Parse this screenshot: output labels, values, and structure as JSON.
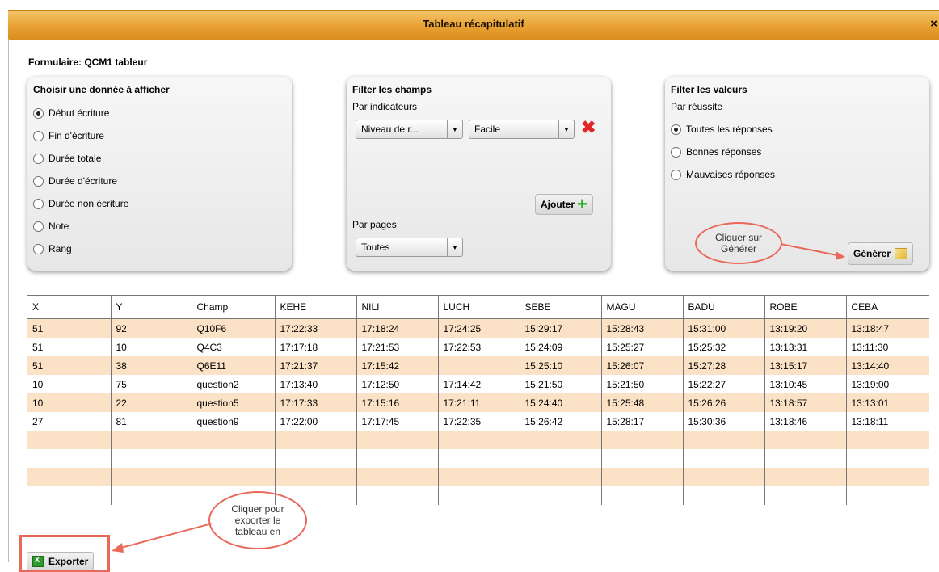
{
  "window": {
    "title": "Tableau récapitulatif",
    "close_label": "×"
  },
  "form_title": "Formulaire: QCM1 tableur",
  "panel_display": {
    "title": "Choisir une donnée à afficher",
    "options": [
      {
        "label": "Début écriture",
        "selected": true
      },
      {
        "label": "Fin d'écriture",
        "selected": false
      },
      {
        "label": "Durée totale",
        "selected": false
      },
      {
        "label": "Durée d'écriture",
        "selected": false
      },
      {
        "label": "Durée non écriture",
        "selected": false
      },
      {
        "label": "Note",
        "selected": false
      },
      {
        "label": "Rang",
        "selected": false
      }
    ]
  },
  "panel_fields": {
    "title": "Filter les champs",
    "indicators_label": "Par indicateurs",
    "indicator_select": "Niveau de r...",
    "level_select": "Facile",
    "delete_icon": "✖",
    "add_label": "Ajouter",
    "add_icon": "+",
    "pages_label": "Par pages",
    "pages_select": "Toutes",
    "arrow_glyph": "▼"
  },
  "panel_values": {
    "title": "Filter les valeurs",
    "subtitle": "Par réussite",
    "options": [
      {
        "label": "Toutes les réponses",
        "selected": true
      },
      {
        "label": "Bonnes réponses",
        "selected": false
      },
      {
        "label": "Mauvaises réponses",
        "selected": false
      }
    ],
    "generate_label": "Générer"
  },
  "callouts": {
    "generate_hint": "Cliquer sur Générer",
    "export_hint": "Cliquer pour exporter le tableau en"
  },
  "table": {
    "columns": [
      "X",
      "Y",
      "Champ",
      "KEHE",
      "NILI",
      "LUCH",
      "SEBE",
      "MAGU",
      "BADU",
      "ROBE",
      "CEBA"
    ],
    "rows": [
      [
        "51",
        "92",
        "Q10F6",
        "17:22:33",
        "17:18:24",
        "17:24:25",
        "15:29:17",
        "15:28:43",
        "15:31:00",
        "13:19:20",
        "13:18:47"
      ],
      [
        "51",
        "10",
        "Q4C3",
        "17:17:18",
        "17:21:53",
        "17:22:53",
        "15:24:09",
        "15:25:27",
        "15:25:32",
        "13:13:31",
        "13:11:30"
      ],
      [
        "51",
        "38",
        "Q6E11",
        "17:21:37",
        "17:15:42",
        "",
        "15:25:10",
        "15:26:07",
        "15:27:28",
        "13:15:17",
        "13:14:40"
      ],
      [
        "10",
        "75",
        "question2",
        "17:13:40",
        "17:12:50",
        "17:14:42",
        "15:21:50",
        "15:21:50",
        "15:22:27",
        "13:10:45",
        "13:19:00"
      ],
      [
        "10",
        "22",
        "question5",
        "17:17:33",
        "17:15:16",
        "17:21:11",
        "15:24:40",
        "15:25:48",
        "15:26:26",
        "13:18:57",
        "13:13:01"
      ],
      [
        "27",
        "81",
        "question9",
        "17:22:00",
        "17:17:45",
        "17:22:35",
        "15:26:42",
        "15:28:17",
        "15:30:36",
        "13:18:46",
        "13:18:11"
      ]
    ],
    "empty_rows": 4
  },
  "export": {
    "label": "Exporter"
  },
  "colors": {
    "title_bar": "#e8a133",
    "row_highlight": "#fbe1c5",
    "annotation": "#e8695a",
    "delete_red": "#e02828",
    "add_green": "#2ab12a"
  }
}
